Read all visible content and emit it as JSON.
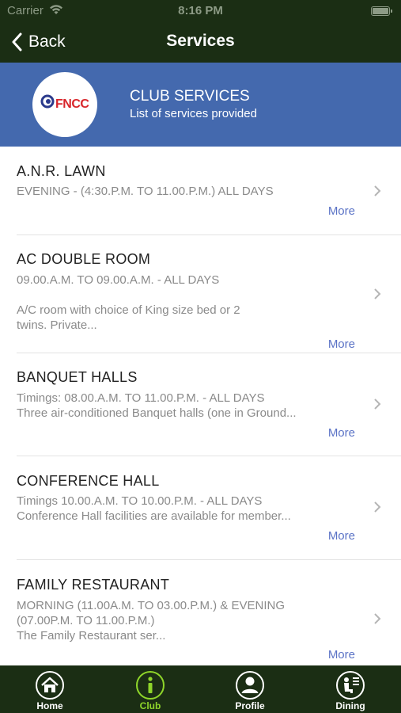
{
  "status_bar": {
    "carrier": "Carrier",
    "time": "8:16 PM"
  },
  "nav": {
    "back_label": "Back",
    "title": "Services"
  },
  "header": {
    "title": "CLUB SERVICES",
    "subtitle": "List of services provided",
    "logo_text": "FNCC"
  },
  "services": [
    {
      "title": "A.N.R. LAWN",
      "lines": [
        "EVENING - (4:30.P.M. TO 11.00.P.M.) ALL DAYS"
      ],
      "more": "More"
    },
    {
      "title": "AC DOUBLE ROOM",
      "lines": [
        "09.00.A.M. TO 09.00.A.M. - ALL DAYS",
        "",
        "A/C room with choice of King size bed or 2",
        "twins. Private..."
      ],
      "more": "More"
    },
    {
      "title": "BANQUET HALLS",
      "lines": [
        "Timings: 08.00.A.M. TO 11.00.P.M. - ALL DAYS",
        "Three air-conditioned Banquet halls (one in Ground..."
      ],
      "more": "More"
    },
    {
      "title": "CONFERENCE HALL",
      "lines": [
        "Timings 10.00.A.M. TO 10.00.P.M. - ALL DAYS",
        "Conference Hall facilities are available for member..."
      ],
      "more": "More"
    },
    {
      "title": "FAMILY RESTAURANT",
      "lines": [
        "MORNING (11.00A.M. TO 03.00.P.M.) & EVENING",
        "(07.00P.M. TO 11.00.P.M.)",
        "The Family Restaurant ser..."
      ],
      "more": "More"
    }
  ],
  "tabs": [
    {
      "label": "Home",
      "icon": "home-icon"
    },
    {
      "label": "Club",
      "icon": "info-icon",
      "active": true
    },
    {
      "label": "Profile",
      "icon": "profile-icon"
    },
    {
      "label": "Dining",
      "icon": "dining-icon"
    }
  ],
  "colors": {
    "bar_bg": "#1b2e14",
    "header_bg": "#4469ae",
    "accent": "#8fd62a",
    "link": "#5b73c6"
  }
}
